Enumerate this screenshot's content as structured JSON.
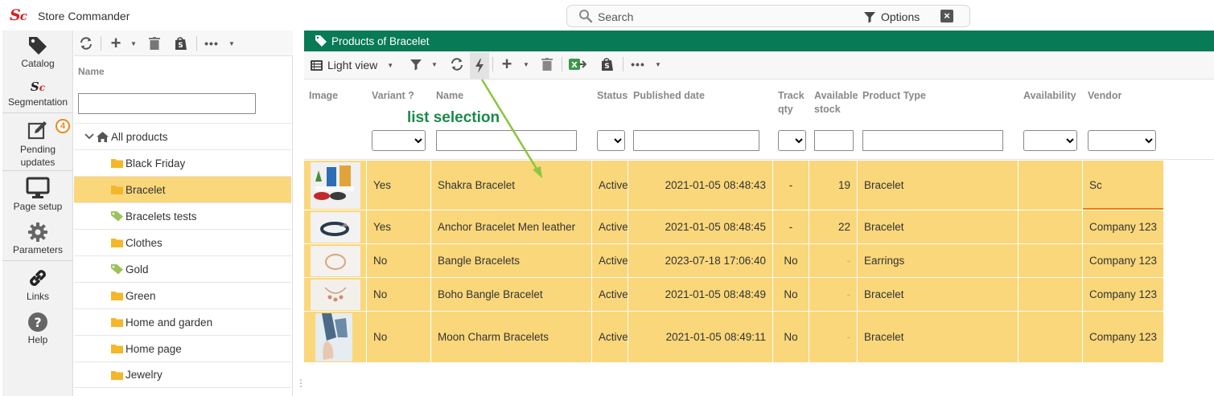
{
  "app": {
    "logo_main": "S",
    "logo_accent": "c",
    "title": "Store Commander"
  },
  "search": {
    "placeholder": "Search",
    "options_label": "Options"
  },
  "rail": {
    "items": [
      {
        "label": "Catalog",
        "icon": "tag-icon"
      },
      {
        "label": "Segmentation",
        "icon": "sc-logo-icon"
      },
      {
        "label": "Pending updates",
        "icon": "edit-icon",
        "badge": "4"
      },
      {
        "label": "Page setup",
        "icon": "monitor-icon"
      },
      {
        "label": "Parameters",
        "icon": "gear-icon"
      },
      {
        "label": "Links",
        "icon": "link-icon"
      },
      {
        "label": "Help",
        "icon": "help-icon"
      }
    ]
  },
  "categories": {
    "column_header": "Name",
    "filter_value": "",
    "items": [
      {
        "label": "All products",
        "icon": "home-icon",
        "expanded": true,
        "selected": false
      },
      {
        "label": "Black Friday",
        "icon": "folder-icon",
        "selected": false
      },
      {
        "label": "Bracelet",
        "icon": "folder-icon",
        "selected": true
      },
      {
        "label": "Bracelets tests",
        "icon": "tag-icon",
        "selected": false
      },
      {
        "label": "Clothes",
        "icon": "folder-icon",
        "selected": false
      },
      {
        "label": "Gold",
        "icon": "tag-icon",
        "selected": false
      },
      {
        "label": "Green",
        "icon": "folder-icon",
        "selected": false
      },
      {
        "label": "Home and garden",
        "icon": "folder-icon",
        "selected": false
      },
      {
        "label": "Home page",
        "icon": "folder-icon",
        "selected": false
      },
      {
        "label": "Jewelry",
        "icon": "folder-icon",
        "selected": false
      }
    ]
  },
  "products": {
    "panel_title": "Products of Bracelet",
    "view_label": "Light view",
    "annotation": "list selection",
    "columns": {
      "image": "Image",
      "variant": "Variant ?",
      "name": "Name",
      "status": "Status",
      "published": "Published date",
      "track_qty_1": "Track",
      "track_qty_2": "qty",
      "stock_1": "Available",
      "stock_2": "stock",
      "type": "Product Type",
      "availability": "Availability",
      "vendor": "Vendor"
    },
    "rows": [
      {
        "variant": "Yes",
        "name": "Shakra Bracelet",
        "status": "Active",
        "published": "2021-01-05 08:48:43",
        "track_qty": "-",
        "stock": "19",
        "type": "Bracelet",
        "availability": "",
        "vendor": "Sc"
      },
      {
        "variant": "Yes",
        "name": "Anchor Bracelet Men leather",
        "status": "Active",
        "published": "2021-01-05 08:48:45",
        "track_qty": "-",
        "stock": "22",
        "type": "Bracelet",
        "availability": "",
        "vendor": "Company 123"
      },
      {
        "variant": "No",
        "name": "Bangle Bracelets",
        "status": "Active",
        "published": "2023-07-18 17:06:40",
        "track_qty": "No",
        "stock": "-",
        "type": "Earrings",
        "availability": "",
        "vendor": "Company 123"
      },
      {
        "variant": "No",
        "name": "Boho Bangle Bracelet",
        "status": "Active",
        "published": "2021-01-05 08:48:49",
        "track_qty": "No",
        "stock": "-",
        "type": "Bracelet",
        "availability": "",
        "vendor": "Company 123"
      },
      {
        "variant": "No",
        "name": "Moon Charm Bracelets",
        "status": "Active",
        "published": "2021-01-05 08:49:11",
        "track_qty": "No",
        "stock": "-",
        "type": "Bracelet",
        "availability": "",
        "vendor": "Company 123"
      }
    ]
  },
  "colors": {
    "header_green": "#087a56",
    "selection_yellow": "#fad77a",
    "annotation_green": "#1a8a4a",
    "badge_orange": "#e88a1a",
    "logo_red": "#d9201f"
  }
}
